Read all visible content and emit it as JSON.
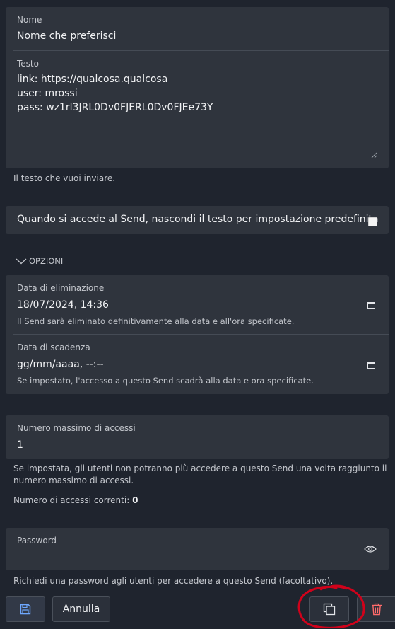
{
  "nome": {
    "label": "Nome",
    "value": "Nome che preferisci"
  },
  "testo": {
    "label": "Testo",
    "lines": [
      "link: https://qualcosa.qualcosa",
      "user: mrossi",
      "pass: wz1rl3JRL0Dv0FJERL0Dv0FJEe73Y"
    ],
    "help": "Il testo che vuoi inviare."
  },
  "hide_text": {
    "label": "Quando si accede al Send, nascondi il testo per impostazione predefinita",
    "checked": false
  },
  "options_label": "OPZIONI",
  "deletion": {
    "label": "Data di eliminazione",
    "value": "18/07/2024, 14:36",
    "help": "Il Send sarà eliminato definitivamente alla data e all'ora specificate."
  },
  "expiration": {
    "label": "Data di scadenza",
    "value": "gg/mm/aaaa, --:--",
    "help": "Se impostato, l'accesso a questo Send scadrà alla data e ora specificate."
  },
  "max_access": {
    "label": "Numero massimo di accessi",
    "value": "1",
    "help_1": "Se impostata, gli utenti non potranno più accedere a questo Send una volta raggiunto il",
    "help_2": "numero massimo di accessi.",
    "current_label": "Numero di accessi correnti:",
    "current_value": "0"
  },
  "password": {
    "label": "Password",
    "help": "Richiedi una password agli utenti per accedere a questo Send (facoltativo)."
  },
  "footer": {
    "cancel_label": "Annulla"
  },
  "colors": {
    "accent": "#6ea8ff",
    "danger": "#ff6b6b",
    "annotation": "#d0021b"
  }
}
